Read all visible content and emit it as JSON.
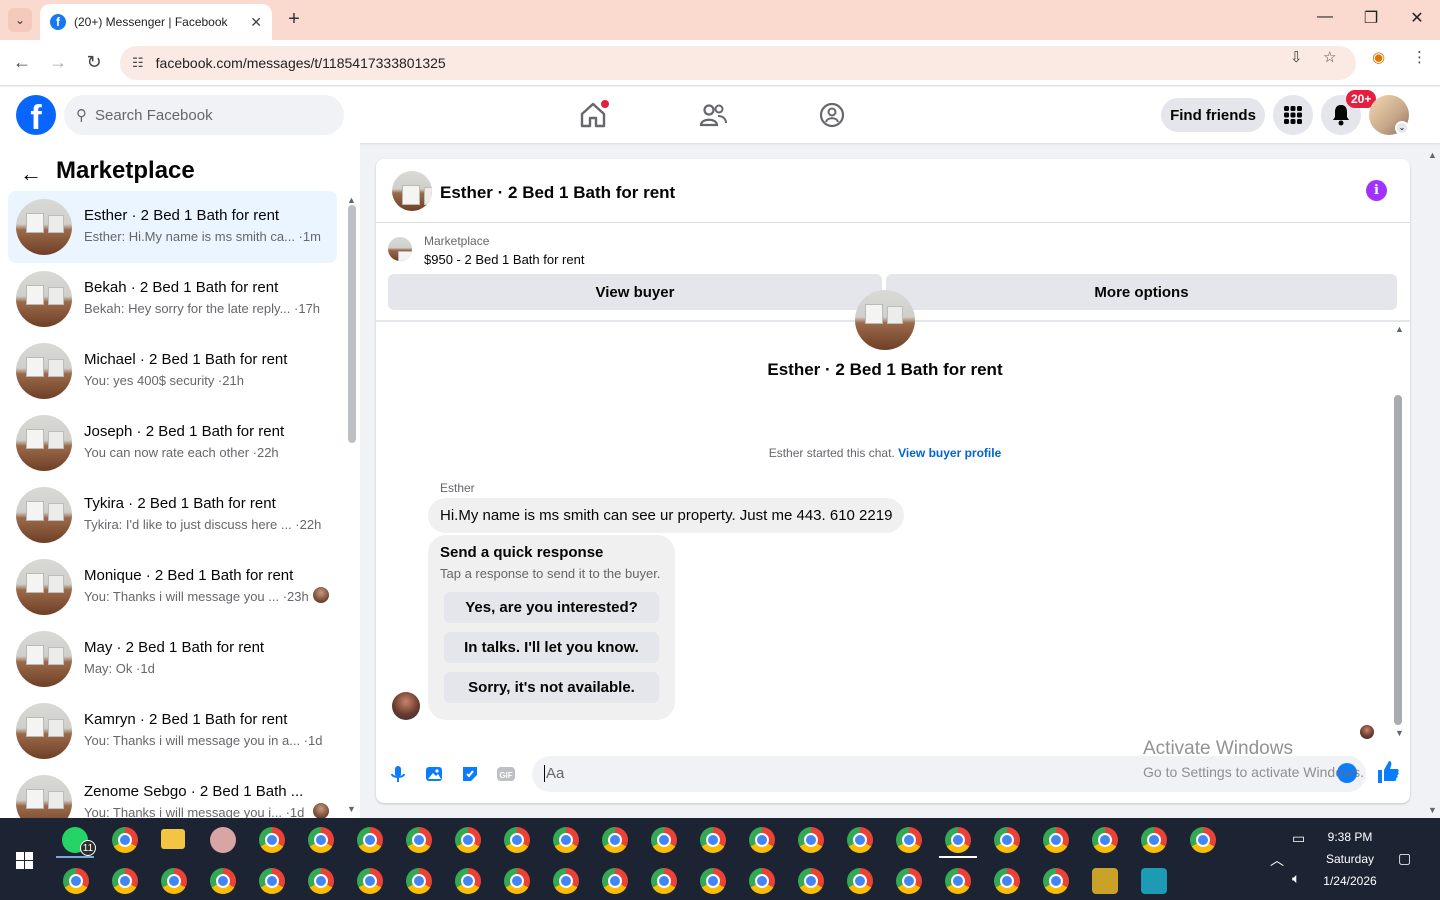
{
  "browser": {
    "tab_title": "(20+) Messenger | Facebook",
    "url": "facebook.com/messages/t/1185417333801325"
  },
  "fb_header": {
    "search_placeholder": "Search Facebook",
    "find_friends": "Find friends",
    "notification_badge": "20+"
  },
  "sidebar": {
    "title": "Marketplace",
    "conversations": [
      {
        "name": "Esther · 2 Bed 1 Bath for rent",
        "snippet": "Esther: Hi.My name is ms smith ca... ·1m",
        "active": true
      },
      {
        "name": "Bekah · 2 Bed 1 Bath for rent",
        "snippet": "Bekah: Hey sorry for the late reply... ·17h"
      },
      {
        "name": "Michael · 2 Bed 1 Bath for rent",
        "snippet": "You: yes 400$ security ·21h"
      },
      {
        "name": "Joseph · 2 Bed 1 Bath for rent",
        "snippet": "You can now rate each other ·22h"
      },
      {
        "name": "Tykira · 2 Bed 1 Bath for rent",
        "snippet": "Tykira: I'd like to just discuss here ... ·22h"
      },
      {
        "name": "Monique · 2 Bed 1 Bath for rent",
        "snippet": "You: Thanks i will message you ... ·23h"
      },
      {
        "name": "May · 2 Bed 1 Bath for rent",
        "snippet": "May: Ok ·1d"
      },
      {
        "name": "Kamryn · 2 Bed 1 Bath for rent",
        "snippet": "You: Thanks i will message you in a... ·1d"
      },
      {
        "name": "Zenome Sebgo · 2 Bed 1 Bath ...",
        "snippet": "You: Thanks i will message you i... ·1d"
      }
    ]
  },
  "chat": {
    "header_name": "Esther · 2 Bed 1 Bath for rent",
    "listing_label": "Marketplace",
    "listing_price": "$950 - 2 Bed 1 Bath for rent",
    "view_buyer": "View buyer",
    "more_options": "More options",
    "center_name": "Esther · 2 Bed 1 Bath for rent",
    "started_text": "Esther started this chat.",
    "view_buyer_profile": "View buyer profile",
    "sender": "Esther",
    "message": "Hi.My name is ms smith can see ur property. Just me 443. 610 2219",
    "quick_title": "Send a quick response",
    "quick_sub": "Tap a response to send it to the buyer.",
    "quick_options": [
      "Yes, are you interested?",
      "In talks. I'll let you know.",
      "Sorry, it's not available."
    ],
    "composer_placeholder": "Aa"
  },
  "watermark": {
    "line1": "Activate Windows",
    "line2": "Go to Settings to activate Windows."
  },
  "taskbar": {
    "whatsapp_badge": "11",
    "time": "9:38 PM",
    "day": "Saturday",
    "date": "1/24/2026"
  },
  "colors": {
    "fb_blue": "#0866ff",
    "active_row": "#ebf5ff",
    "badge_red": "#e41e3f",
    "info_purple": "#a033ff"
  }
}
